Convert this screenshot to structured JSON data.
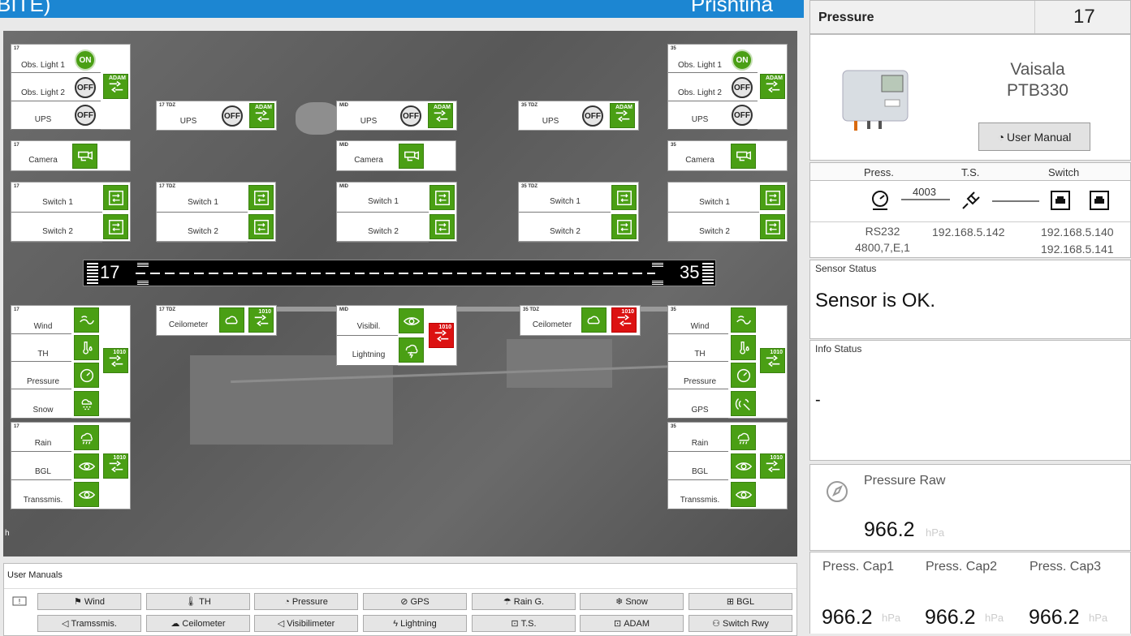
{
  "header": {
    "left": "BITE)",
    "right": "Prishtina"
  },
  "map": {
    "p1": {
      "tag": "17",
      "r1": "Obs. Light 1",
      "s1": "ON",
      "r2": "Obs. Light 2",
      "s2": "OFF",
      "r3": "UPS",
      "s3": "OFF",
      "adam": "ADAM"
    },
    "p2": {
      "tag": "35",
      "r1": "Obs. Light 1",
      "s1": "ON",
      "r2": "Obs. Light 2",
      "s2": "OFF",
      "r3": "UPS",
      "s3": "OFF",
      "adam": "ADAM"
    },
    "ups17tdz": {
      "tag": "17 TDZ",
      "label": "UPS",
      "state": "OFF",
      "adam": "ADAM"
    },
    "upsmid": {
      "tag": "MID",
      "label": "UPS",
      "state": "OFF",
      "adam": "ADAM"
    },
    "ups35tdz": {
      "tag": "35 TDZ",
      "label": "UPS",
      "state": "OFF",
      "adam": "ADAM"
    },
    "cam17": {
      "tag": "17",
      "label": "Camera"
    },
    "cammid": {
      "tag": "MID",
      "label": "Camera"
    },
    "cam35": {
      "tag": "35",
      "label": "Camera"
    },
    "sw17": {
      "tag": "17",
      "r1": "Switch 1",
      "r2": "Switch 2"
    },
    "sw17tdz": {
      "tag": "17 TDZ",
      "r1": "Switch 1",
      "r2": "Switch 2"
    },
    "swmid": {
      "tag": "MID",
      "r1": "Switch 1",
      "r2": "Switch 2"
    },
    "sw35tdz": {
      "tag": "35 TDZ",
      "r1": "Switch 1",
      "r2": "Switch 2"
    },
    "sw35": {
      "tag": "",
      "r1": "Switch 1",
      "r2": "Switch 2"
    },
    "runway": {
      "left": "17",
      "right": "35"
    },
    "w17": {
      "tag": "17",
      "r1": "Wind",
      "r2": "TH",
      "r3": "Pressure",
      "r4": "Snow",
      "serial": "1010"
    },
    "c17tdz": {
      "tag": "17 TDZ",
      "label": "Ceilometer",
      "serial": "1010"
    },
    "vmid": {
      "tag": "MID",
      "r1": "Visibil.",
      "r2": "Lightning",
      "serial": "1010"
    },
    "c35tdz": {
      "tag": "35 TDZ",
      "label": "Ceilometer",
      "serial": "1010"
    },
    "w35": {
      "tag": "35",
      "r1": "Wind",
      "r2": "TH",
      "r3": "Pressure",
      "r4": "GPS",
      "serial": "1010"
    },
    "r17": {
      "tag": "17",
      "r1": "Rain",
      "r2": "BGL",
      "r3": "Transsmis.",
      "serial": "1010"
    },
    "r35": {
      "tag": "35",
      "r1": "Rain",
      "r2": "BGL",
      "r3": "Transsmis.",
      "serial": "1010"
    },
    "corner": "h"
  },
  "manuals": {
    "title": "User Manuals",
    "buttons": [
      "Wind",
      "TH",
      "Pressure",
      "GPS",
      "Rain G.",
      "Snow",
      "BGL",
      "Tramssmis.",
      "Ceilometer",
      "Visibilimeter",
      "Lightning",
      "T.S.",
      "ADAM",
      "Switch Rwy"
    ]
  },
  "side": {
    "title": "Pressure",
    "number": "17",
    "model1": "Vaisala",
    "model2": "PTB330",
    "manual": "User Manual",
    "conn": {
      "h1": "Press.",
      "h2": "T.S.",
      "h3": "Switch",
      "port": "4003",
      "rs": "RS232",
      "cfg": "4800,7,E,1",
      "ts_ip": "192.168.5.142",
      "sw_ip1": "192.168.5.140",
      "sw_ip2": "192.168.5.141"
    },
    "sensor": {
      "label": "Sensor Status",
      "value": "Sensor is OK."
    },
    "info": {
      "label": "Info Status",
      "value": "-"
    },
    "raw": {
      "label": "Pressure Raw",
      "value": "966.2",
      "unit": "hPa"
    },
    "caps": [
      {
        "label": "Press. Cap1",
        "value": "966.2",
        "unit": "hPa"
      },
      {
        "label": "Press. Cap2",
        "value": "966.2",
        "unit": "hPa"
      },
      {
        "label": "Press. Cap3",
        "value": "966.2",
        "unit": "hPa"
      }
    ]
  }
}
